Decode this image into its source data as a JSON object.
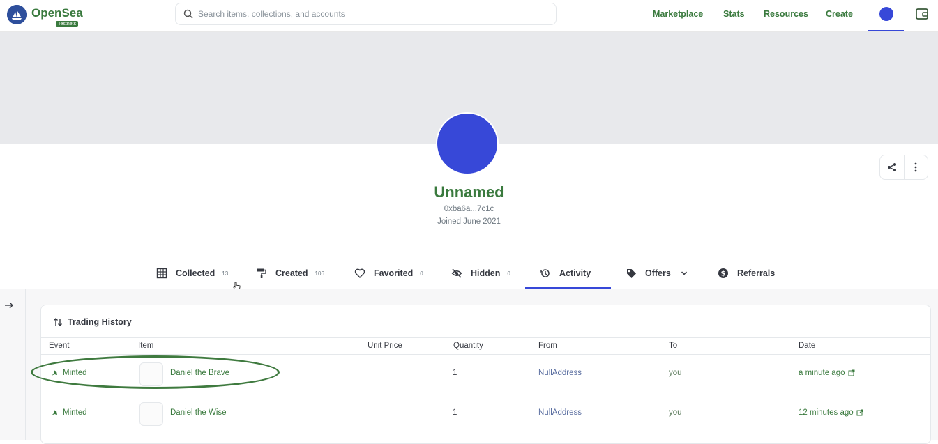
{
  "nav": {
    "brand": "OpenSea",
    "badge": "Testnets",
    "search_placeholder": "Search items, collections, and accounts",
    "links": [
      "Marketplace",
      "Stats",
      "Resources",
      "Create"
    ]
  },
  "profile": {
    "name": "Unnamed",
    "address": "0xba6a...7c1c",
    "joined": "Joined June 2021",
    "avatar_color": "#3748d8"
  },
  "tabs": [
    {
      "label": "Collected",
      "count": "13",
      "icon": "grid-icon"
    },
    {
      "label": "Created",
      "count": "106",
      "icon": "paint-roller-icon"
    },
    {
      "label": "Favorited",
      "count": "0",
      "icon": "heart-icon"
    },
    {
      "label": "Hidden",
      "count": "0",
      "icon": "eye-off-icon"
    },
    {
      "label": "Activity",
      "count": "",
      "icon": "history-icon",
      "active": true
    },
    {
      "label": "Offers",
      "count": "",
      "icon": "tag-icon"
    },
    {
      "label": "Referrals",
      "count": "",
      "icon": "dollar-icon"
    }
  ],
  "trading": {
    "title": "Trading History",
    "columns": [
      "Event",
      "Item",
      "Unit Price",
      "Quantity",
      "From",
      "To",
      "Date"
    ],
    "rows": [
      {
        "event": "Minted",
        "item": "Daniel the Brave",
        "unit_price": "",
        "quantity": "1",
        "from": "NullAddress",
        "to": "you",
        "date": "a minute ago"
      },
      {
        "event": "Minted",
        "item": "Daniel the Wise",
        "unit_price": "",
        "quantity": "1",
        "from": "NullAddress",
        "to": "you",
        "date": "12 minutes ago"
      }
    ]
  },
  "colors": {
    "accent_green": "#3a7a3e",
    "accent_blue": "#3748d8"
  }
}
